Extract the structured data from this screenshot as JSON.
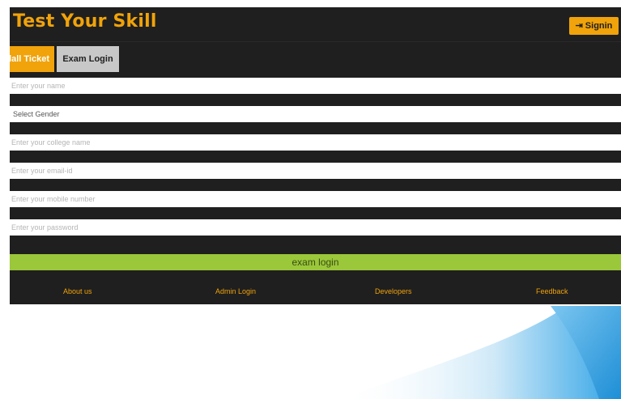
{
  "brand": {
    "title": "Test Your Skill"
  },
  "header": {
    "signin_label": "Signin",
    "signin_icon": "sign-in-icon"
  },
  "tabs": [
    {
      "label": "Hall Ticket",
      "visible_label": "lall Ticket",
      "active": true
    },
    {
      "label": "Exam Login",
      "active": false
    }
  ],
  "form": {
    "name_placeholder": "Enter your name",
    "gender_label": "Select Gender",
    "college_placeholder": "Enter your college name",
    "email_placeholder": "Enter your email-id",
    "mobile_placeholder": "Enter your mobile number",
    "password_placeholder": "Enter your password",
    "submit_label": "exam login"
  },
  "footer": {
    "links": [
      "About us",
      "Admin Login",
      "Developers",
      "Feedback"
    ]
  },
  "colors": {
    "accent": "#f0a30a",
    "dark": "#1f1f1f",
    "submit": "#9bc73a",
    "tab_inactive": "#c8c8c8",
    "swoosh": "#2fa3e6"
  }
}
